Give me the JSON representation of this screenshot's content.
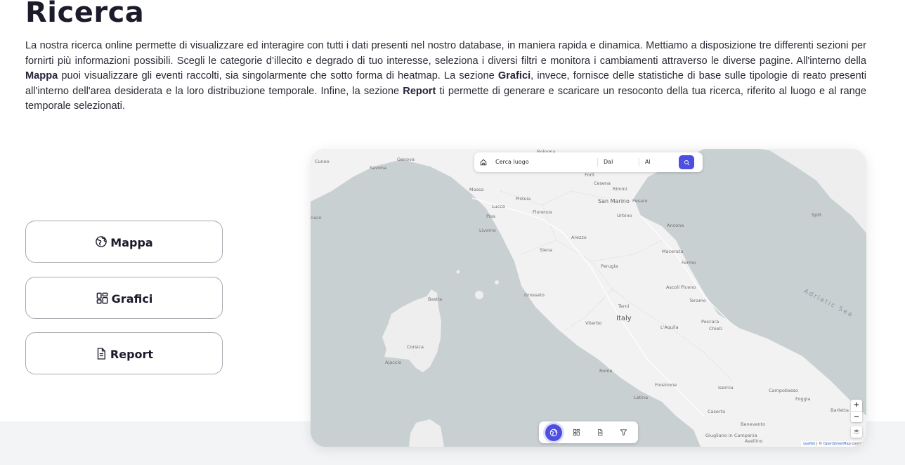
{
  "page": {
    "title": "Ricerca",
    "intro": {
      "p1": "La nostra ricerca online permette di visualizzare ed interagire con tutti i dati presenti nel nostro database, in maniera rapida e dinamica. Mettiamo a disposizione tre differenti sezioni per fornirti più informazioni possibili. Scegli le categorie d’illecito e degrado di tuo interesse, seleziona i diversi filtri e monitora i cambiamenti attraverso le diverse pagine. All'interno della ",
      "b1": "Mappa",
      "p2": " puoi visualizzare gli eventi raccolti, sia singolarmente che sotto forma di heatmap. La sezione ",
      "b2": "Grafici",
      "p3": ", invece, fornisce delle statistiche di base sulle tipologie di reato presenti all'interno dell'area desiderata e la loro distribuzione temporale. Infine, la sezione ",
      "b3": "Report",
      "p4": " ti permette di generare e scaricare un resoconto della tua ricerca, riferito al luogo e al range temporale selezionati."
    }
  },
  "sections": [
    {
      "label": "Mappa",
      "icon": "globe-icon"
    },
    {
      "label": "Grafici",
      "icon": "grid-icon"
    },
    {
      "label": "Report",
      "icon": "document-icon"
    }
  ],
  "map": {
    "search": {
      "place_placeholder": "Cerca luogo",
      "from_placeholder": "Dal",
      "to_placeholder": "Al"
    },
    "toolbar": [
      "globe-icon",
      "grid-icon",
      "document-icon",
      "filter-icon"
    ],
    "zoom": {
      "in": "+",
      "out": "−"
    },
    "attribution": {
      "leaflet": "Leaflet",
      "sep": " | © ",
      "osm": "OpenStreetMap",
      "rest": " contrib"
    },
    "labels": {
      "italy": "Italy",
      "adriatic": "Adriatic Sea",
      "san_marino": "San Marino",
      "bologna": "Bologna",
      "genova": "Genova",
      "cuneo": "Cuneo",
      "savona": "Savona",
      "massa": "Massa",
      "lucca": "Lucca",
      "pistoia": "Pistoia",
      "pisa": "Pisa",
      "florence": "Florence",
      "livorno": "Livorno",
      "arezzo": "Arezzo",
      "siena": "Siena",
      "perugia": "Perugia",
      "forli": "Forlì",
      "cesena": "Cesena",
      "rimini": "Rimini",
      "pesaro": "Pesaro",
      "urbino": "Urbino",
      "ancona": "Ancona",
      "macerata": "Macerata",
      "fermo": "Fermo",
      "ascoli": "Ascoli Piceno",
      "teramo": "Teramo",
      "laquila": "L'Aquila",
      "chieti": "Chieti",
      "pescara": "Pescara",
      "terni": "Terni",
      "viterbo": "Viterbo",
      "grosseto": "Grosseto",
      "rome": "Rome",
      "latina": "Latina",
      "frosinone": "Frosinone",
      "isernia": "Isernia",
      "campobasso": "Campobasso",
      "foggia": "Foggia",
      "benevento": "Benevento",
      "avellino": "Avellino",
      "bastia": "Bastia",
      "corsica": "Corsica",
      "ajaccio": "Ajaccio",
      "split": "Split",
      "barletta": "Barletta",
      "monaco": "naco",
      "giugliano": "Giugliano in Campania",
      "caserta": "Caserta"
    }
  }
}
